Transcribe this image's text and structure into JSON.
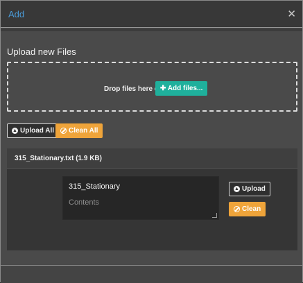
{
  "dialog": {
    "title": "Add",
    "close_glyph": "✕"
  },
  "upload": {
    "heading": "Upload new Files",
    "drop_text": "Drop files here or",
    "add_files_label": "Add files...",
    "upload_all_label": "Upload All",
    "clean_all_label": "Clean All"
  },
  "file": {
    "name": "315_Stationary.txt",
    "size": "(1.9 KB)",
    "title_value": "315_Stationary",
    "contents_placeholder": "Contents",
    "upload_label": "Upload",
    "clean_label": "Clean"
  },
  "colors": {
    "accent_blue": "#4a9bd8",
    "add_button": "#1fb09c",
    "warning": "#efa43a"
  },
  "icons": {
    "close": "close-icon",
    "plus": "plus-icon",
    "upload": "upload-circle-icon",
    "clean": "ban-icon"
  }
}
